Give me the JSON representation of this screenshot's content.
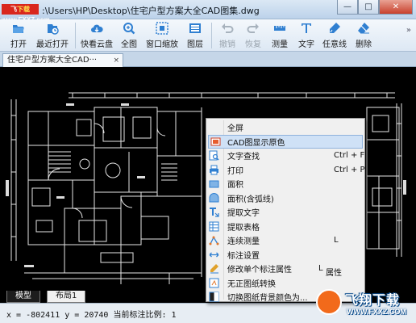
{
  "window": {
    "site_badge_prefix": "飞",
    "site_badge_main": "下载 ",
    "site_badge_domain": "www.FXXZ.com",
    "title": ":\\Users\\HP\\Desktop\\住宅户型方案大全CAD图集.dwg",
    "minimize_glyph": "—",
    "maximize_glyph": "□",
    "close_glyph": "✕"
  },
  "toolbar": {
    "items": [
      {
        "label": "打开",
        "icon": "folder-open-icon",
        "enabled": true
      },
      {
        "label": "最近打开",
        "icon": "recent-icon",
        "enabled": true
      },
      {
        "label": "快看云盘",
        "icon": "cloud-icon",
        "enabled": true
      },
      {
        "label": "全图",
        "icon": "full-view-icon",
        "enabled": true
      },
      {
        "label": "窗口缩放",
        "icon": "window-zoom-icon",
        "enabled": true
      },
      {
        "label": "图层",
        "icon": "layers-icon",
        "enabled": true
      },
      {
        "label": "撤销",
        "icon": "undo-icon",
        "enabled": false
      },
      {
        "label": "恢复",
        "icon": "redo-icon",
        "enabled": false
      },
      {
        "label": "测量",
        "icon": "measure-icon",
        "enabled": true
      },
      {
        "label": "文字",
        "icon": "text-icon",
        "enabled": true
      },
      {
        "label": "任意线",
        "icon": "freeline-icon",
        "enabled": true
      },
      {
        "label": "删除",
        "icon": "eraser-icon",
        "enabled": true
      }
    ],
    "more_glyph": "»"
  },
  "document_tab": {
    "label": "住宅户型方案大全CAD···",
    "close_glyph": "×"
  },
  "layout_tabs": {
    "model": "模型",
    "layout1": "布局1"
  },
  "status": {
    "text": "x = -802411  y = 20740  当前标注比例: 1"
  },
  "context_menu": {
    "items": [
      {
        "label": "全屏",
        "shortcut": "",
        "icon": "none"
      },
      {
        "label": "CAD图显示原色",
        "shortcut": "",
        "icon": "cad-color-icon",
        "selected": true
      },
      {
        "label": "文字查找",
        "shortcut": "Ctrl + F",
        "icon": "text-find-icon"
      },
      {
        "label": "打印",
        "shortcut": "Ctrl + P",
        "icon": "print-icon"
      },
      {
        "label": "面积",
        "shortcut": "",
        "icon": "area-icon"
      },
      {
        "label": "面积(含弧线)",
        "shortcut": "",
        "icon": "area-arc-icon"
      },
      {
        "label": "提取文字",
        "shortcut": "",
        "icon": "extract-text-icon"
      },
      {
        "label": "提取表格",
        "shortcut": "",
        "icon": "extract-table-icon"
      },
      {
        "label": "连续测量",
        "shortcut": "L",
        "icon": "continuous-measure-icon"
      },
      {
        "label": "标注设置",
        "shortcut": "",
        "icon": "annotation-settings-icon"
      },
      {
        "label": "修改单个标注属性",
        "shortcut": "L",
        "icon": "edit-annotation-icon"
      },
      {
        "label": "无正图纸转换",
        "shortcut": "",
        "icon": "convert-drawing-icon"
      },
      {
        "label": "切换图纸背景颜色为...",
        "shortcut": "",
        "icon": "bg-color-icon"
      }
    ],
    "floating_label": "属性"
  },
  "watermark": {
    "title": "飞翔下载",
    "url": "WWW.FXXZ.COM"
  },
  "colors": {
    "canvas_bg": "#000000",
    "drawing_lines": "#e8e8e8",
    "menu_bg": "#f0f0f0",
    "menu_selected": "#cfe1f6",
    "accent_blue": "#2f7fd1"
  }
}
